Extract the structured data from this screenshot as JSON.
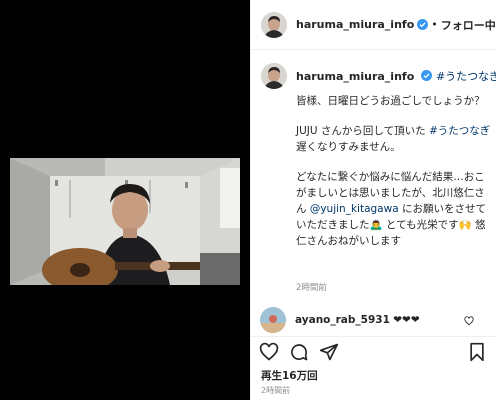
{
  "post": {
    "username": "haruma_miura_info",
    "follow_status": "フォロー中",
    "hashtag": "#うたつなぎ"
  },
  "caption": {
    "p1": "皆様、日曜日どうお過ごしでしょうか？",
    "p2_a": "JUJU さんから回して頂いた",
    "p2_tag": "#うたつなぎ",
    "p2_b": "遅くなりすみません。",
    "p3_a": "どなたに繋ぐか悩みに悩んだ結果…おこがましいとは思いましたが、北川悠仁さん",
    "p3_mention": "@yujin_kitagawa",
    "p3_b": "にお願いをさせていただきました🙇‍♂️ とても光栄です🙌 悠仁さんおねがいします",
    "time": "2時間前"
  },
  "reply": {
    "username": "ayano_rab_5931",
    "text": "❤❤❤"
  },
  "footer": {
    "views": "再生16万回",
    "time": "2時間前"
  },
  "icons": {
    "verified": "verified-badge-icon",
    "like": "heart-icon",
    "comment": "comment-bubble-icon",
    "share": "paper-plane-icon",
    "save": "bookmark-icon"
  },
  "colors": {
    "verified": "#3897f0",
    "link": "#00376b",
    "muted": "#8e8e8e"
  }
}
